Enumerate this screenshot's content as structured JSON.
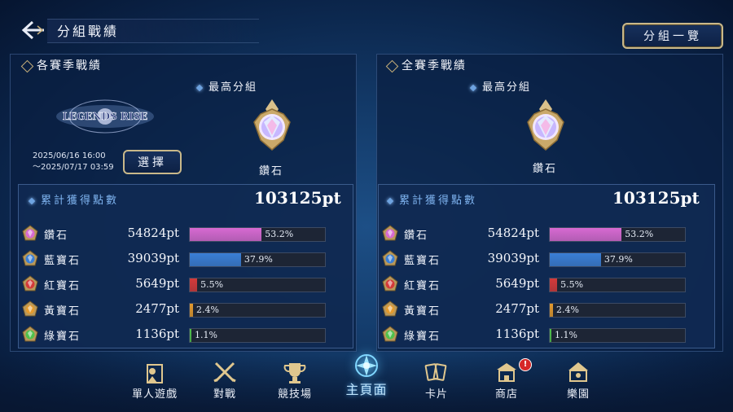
{
  "header": {
    "title": "分組戰績",
    "list_button": "分組一覽"
  },
  "left_panel": {
    "section_title": "各賽季戰績",
    "logo_text": "LEGENDS RISE",
    "date_range": [
      "2025/06/16 16:00",
      "～2025/07/17 03:59"
    ],
    "select_button": "選擇",
    "best_label": "最高分組",
    "best_tier": "鑽石",
    "points_label": "累計獲得點數",
    "total": "103125pt",
    "tiers": [
      {
        "name": "鑽石",
        "points": "54824pt",
        "pct_text": "53.2%",
        "pct": 53.2,
        "color": "#d76ad2",
        "icon": "diamond-tier-icon"
      },
      {
        "name": "藍寶石",
        "points": "39039pt",
        "pct_text": "37.9%",
        "pct": 37.9,
        "color": "#3a7fd6",
        "icon": "sapphire-tier-icon"
      },
      {
        "name": "紅寶石",
        "points": "5649pt",
        "pct_text": "5.5%",
        "pct": 5.5,
        "color": "#d33a3a",
        "icon": "ruby-tier-icon"
      },
      {
        "name": "黃寶石",
        "points": "2477pt",
        "pct_text": "2.4%",
        "pct": 2.4,
        "color": "#e39a2e",
        "icon": "topaz-tier-icon"
      },
      {
        "name": "綠寶石",
        "points": "1136pt",
        "pct_text": "1.1%",
        "pct": 1.1,
        "color": "#4fc24c",
        "icon": "emerald-tier-icon"
      }
    ]
  },
  "right_panel": {
    "section_title": "全賽季戰績",
    "best_label": "最高分組",
    "best_tier": "鑽石",
    "points_label": "累計獲得點數",
    "total": "103125pt",
    "tiers": [
      {
        "name": "鑽石",
        "points": "54824pt",
        "pct_text": "53.2%",
        "pct": 53.2,
        "color": "#d76ad2",
        "icon": "diamond-tier-icon"
      },
      {
        "name": "藍寶石",
        "points": "39039pt",
        "pct_text": "37.9%",
        "pct": 37.9,
        "color": "#3a7fd6",
        "icon": "sapphire-tier-icon"
      },
      {
        "name": "紅寶石",
        "points": "5649pt",
        "pct_text": "5.5%",
        "pct": 5.5,
        "color": "#d33a3a",
        "icon": "ruby-tier-icon"
      },
      {
        "name": "黃寶石",
        "points": "2477pt",
        "pct_text": "2.4%",
        "pct": 2.4,
        "color": "#e39a2e",
        "icon": "topaz-tier-icon"
      },
      {
        "name": "綠寶石",
        "points": "1136pt",
        "pct_text": "1.1%",
        "pct": 1.1,
        "color": "#4fc24c",
        "icon": "emerald-tier-icon"
      }
    ]
  },
  "nav": {
    "items": [
      {
        "label": "單人遊戲",
        "icon": "solo-play-icon"
      },
      {
        "label": "對戰",
        "icon": "crossed-swords-icon"
      },
      {
        "label": "競技場",
        "icon": "trophy-icon"
      },
      {
        "label": "主頁面",
        "icon": "home-crest-icon",
        "active": true
      },
      {
        "label": "卡片",
        "icon": "cards-icon"
      },
      {
        "label": "商店",
        "icon": "shop-icon"
      },
      {
        "label": "樂園",
        "icon": "park-icon"
      }
    ],
    "shop_badge": "!"
  }
}
